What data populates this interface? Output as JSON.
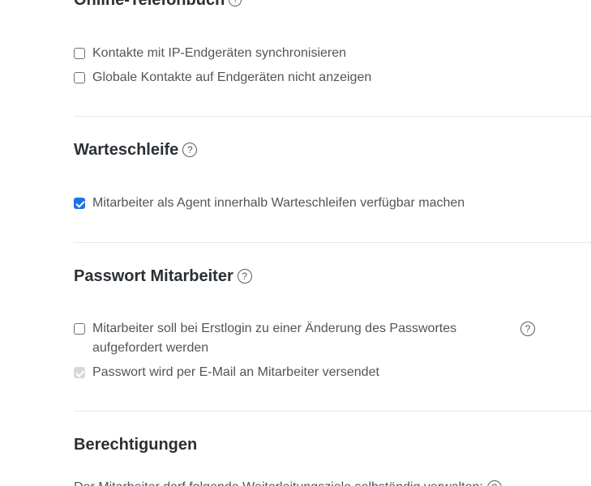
{
  "sections": {
    "phonebook": {
      "title": "Online-Telefonbuch",
      "options": [
        {
          "label": "Kontakte mit IP-Endgeräten synchronisieren",
          "checked": false
        },
        {
          "label": "Globale Kontakte auf Endgeräten nicht anzeigen",
          "checked": false
        }
      ]
    },
    "queue": {
      "title": "Warteschleife",
      "options": [
        {
          "label": "Mitarbeiter als Agent innerhalb Warteschleifen verfügbar machen",
          "checked": true
        }
      ]
    },
    "password": {
      "title": "Passwort Mitarbeiter",
      "options": [
        {
          "label": "Mitarbeiter soll bei Erstlogin zu einer Änderung des Passwortes",
          "label_line2": "aufgefordert werden",
          "checked": false
        },
        {
          "label": "Passwort wird per E-Mail an Mitarbeiter versendet",
          "checked": true,
          "disabled": true
        }
      ]
    },
    "permissions": {
      "title": "Berechtigungen",
      "description": "Der Mitarbeiter darf folgende Weiterleitungsziele selbständig verwalten:"
    }
  },
  "icons": {
    "help": "?"
  },
  "colors": {
    "accent": "#1a73e8",
    "text": "#50565c",
    "heading": "#2b3035",
    "divider": "#e6e8ea"
  }
}
